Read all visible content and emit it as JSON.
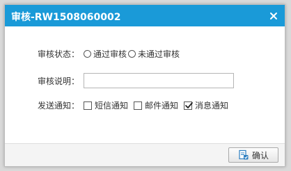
{
  "dialog": {
    "title": "审核-RW1508060002",
    "close_icon": "close-icon"
  },
  "form": {
    "status": {
      "label": "审核状态：",
      "options": [
        "通过审核",
        "未通过审核"
      ],
      "selected": null
    },
    "remark": {
      "label": "审核说明：",
      "value": ""
    },
    "notify": {
      "label": "发送通知：",
      "options": [
        {
          "label": "短信通知",
          "checked": false
        },
        {
          "label": "邮件通知",
          "checked": false
        },
        {
          "label": "消息通知",
          "checked": true
        }
      ]
    }
  },
  "footer": {
    "confirm_label": "确认",
    "confirm_icon": "confirm-icon"
  },
  "colors": {
    "titlebar": "#1a9ad8",
    "footer": "#f4f4f4"
  }
}
